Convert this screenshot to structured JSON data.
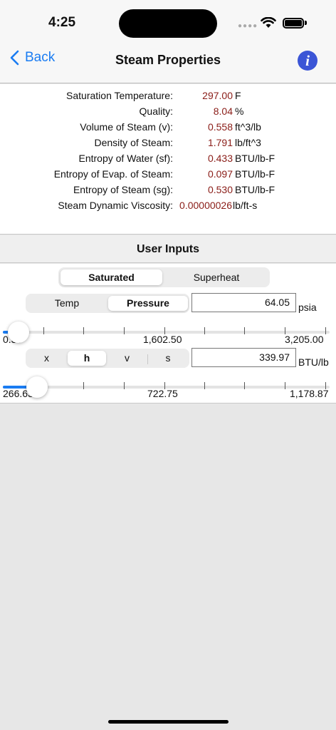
{
  "status": {
    "time": "4:25"
  },
  "nav": {
    "back_label": "Back",
    "title": "Steam Properties",
    "info_glyph": "i"
  },
  "results": [
    {
      "label": "Saturation Temperature:",
      "value": "297.00",
      "unit": "F"
    },
    {
      "label": "Quality:",
      "value": "8.04",
      "unit": "%"
    },
    {
      "label": "Volume of Steam (v):",
      "value": "0.558",
      "unit": "ft^3/lb"
    },
    {
      "label": "Density of Steam:",
      "value": "1.791",
      "unit": "lb/ft^3"
    },
    {
      "label": "Entropy of Water (sf):",
      "value": "0.433",
      "unit": "BTU/lb-F"
    },
    {
      "label": "Entropy of Evap. of Steam:",
      "value": "0.097",
      "unit": "BTU/lb-F"
    },
    {
      "label": "Entropy of Steam (sg):",
      "value": "0.530",
      "unit": "BTU/lb-F"
    },
    {
      "label": "Steam Dynamic Viscosity:",
      "value": "0.00000026",
      "unit": "lb/ft-s"
    }
  ],
  "user_inputs": {
    "title": "User Inputs",
    "mode": {
      "options": [
        "Saturated",
        "Superheat"
      ],
      "selected": "Saturated"
    },
    "basis": {
      "options": [
        "Temp",
        "Pressure"
      ],
      "selected": "Pressure"
    },
    "pressure": {
      "value": "64.05",
      "unit": "psia"
    },
    "pressure_slider": {
      "min_label": "0.39",
      "mid_label": "1,602.50",
      "max_label": "3,205.00",
      "level_fraction": 0.02
    },
    "property": {
      "options": [
        "x",
        "h",
        "v",
        "s"
      ],
      "selected": "h"
    },
    "enthalpy": {
      "value": "339.97",
      "unit": "BTU/lb"
    },
    "enthalpy_slider": {
      "min_label": "266.63",
      "mid_label": "722.75",
      "max_label": "1,178.87",
      "level_fraction": 0.08
    }
  },
  "colors": {
    "accent": "#1a7cf2",
    "value_red": "#8a1c17",
    "info_blue": "#3b55d6"
  }
}
